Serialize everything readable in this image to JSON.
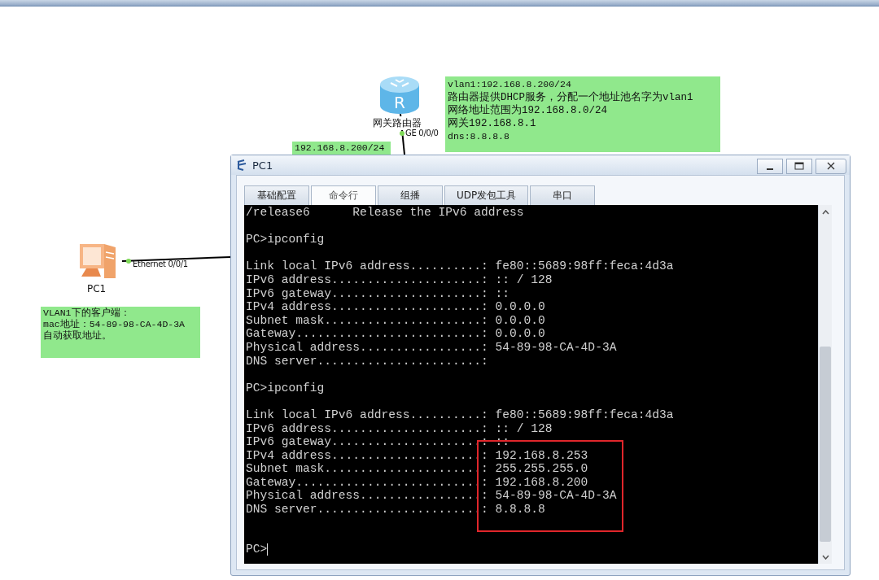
{
  "diagram": {
    "router": {
      "icon_text": "R",
      "label": "网关路由器",
      "port": "GE 0/0/0"
    },
    "pc": {
      "label": "PC1",
      "port": "Ethernet 0/0/1"
    },
    "notes": [
      {
        "lines": [
          "192.168.8.200/24"
        ]
      },
      {
        "lines": [
          "vlan1:192.168.8.200/24",
          "路由器提供DHCP服务，分配一个地址池名字为vlan1",
          "网络地址范围为192.168.8.0/24",
          "网关192.168.8.1",
          "dns:8.8.8.8"
        ]
      },
      {
        "lines": [
          "VLAN1下的客户端：",
          "mac地址：54-89-98-CA-4D-3A",
          "自动获取地址。"
        ]
      }
    ]
  },
  "window": {
    "title": "PC1",
    "tabs": [
      {
        "label": "基础配置",
        "selected": false
      },
      {
        "label": "命令行",
        "selected": true
      },
      {
        "label": "组播",
        "selected": false
      },
      {
        "label": "UDP发包工具",
        "selected": false
      },
      {
        "label": "串口",
        "selected": false
      }
    ],
    "terminal": {
      "blocks": [
        [
          "/release6      Release the IPv6 address"
        ],
        [
          "PC>ipconfig"
        ],
        [
          "Link local IPv6 address..........: fe80::5689:98ff:feca:4d3a",
          "IPv6 address.....................: :: / 128",
          "IPv6 gateway.....................: ::",
          "IPv4 address.....................: 0.0.0.0",
          "Subnet mask......................: 0.0.0.0",
          "Gateway..........................: 0.0.0.0",
          "Physical address.................: 54-89-98-CA-4D-3A",
          "DNS server.......................:"
        ],
        [
          "PC>ipconfig"
        ],
        [
          "Link local IPv6 address..........: fe80::5689:98ff:feca:4d3a",
          "IPv6 address.....................: :: / 128",
          "IPv6 gateway.....................: ::",
          "IPv4 address.....................: 192.168.8.253",
          "Subnet mask......................: 255.255.255.0",
          "Gateway..........................: 192.168.8.200",
          "Physical address.................: 54-89-98-CA-4D-3A",
          "DNS server.......................: 8.8.8.8"
        ]
      ],
      "prompt": "PC>"
    }
  }
}
